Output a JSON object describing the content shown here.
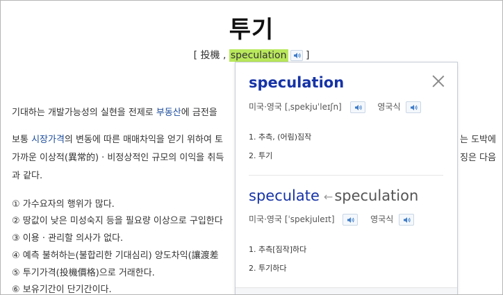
{
  "page": {
    "title": "투기",
    "sub_open": "[ 投機 , ",
    "sub_highlight": "speculation",
    "sub_close": " ]"
  },
  "article": {
    "line1": "기대하는 개발가능성의 실현을 전제로 ",
    "line1_link": "부동산",
    "line1_tail": "에 금전을",
    "line2_head": "보통 ",
    "line2_link": "시장가격",
    "line2_tail": "의 변동에 따른 매매차익을 얻기 위하여 토",
    "line2_right": "는 도박에",
    "line3": "가까운 이상적(異常的) · 비정상적인 규모의 이익을 취득",
    "line3_right": "징은 다음",
    "line4": "과 같다.",
    "items": [
      "① 가수요자의 행위가 많다.",
      "② 땅값이 낮은 미성숙지 등을 필요량 이상으로 구입한다",
      "③ 이용 · 관리할 의사가 없다.",
      "④ 예측 불허하는(불합리한 기대심리) 양도차익(讓渡差",
      "⑤ 투기가격(投機價格)으로 거래한다.",
      "⑥ 보유기간이 단기간이다."
    ]
  },
  "popup": {
    "entry1": {
      "headword": "speculation",
      "pron_us_label": "미국·영국",
      "pron_us": "[ˌspekjuˈleɪʃn]",
      "pron_uk_label": "영국식",
      "meanings": [
        "1.  추측, (어림)짐작",
        "2.  투기"
      ]
    },
    "entry2": {
      "headword": "speculate",
      "arrow": "←",
      "base": "speculation",
      "pron_us_label": "미국·영국",
      "pron_us": "[ˈspekjuleɪt]",
      "pron_uk_label": "영국식",
      "meanings": [
        "1.  추측[짐작]하다",
        "2.  투기하다"
      ]
    }
  },
  "colors": {
    "highlight": "#b9e85c",
    "headword": "#1633a6",
    "link": "#1a4b9b"
  },
  "icons": {
    "speaker": "speaker-icon",
    "close": "close-icon"
  }
}
